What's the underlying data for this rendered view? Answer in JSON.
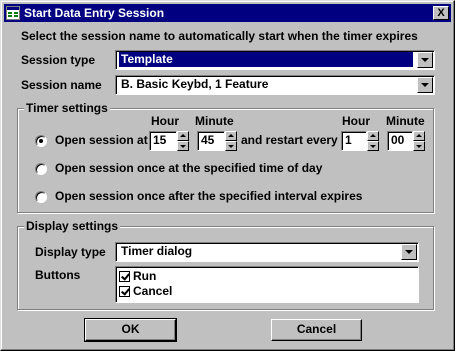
{
  "window": {
    "title": "Start Data Entry Session",
    "close_label": "X",
    "app_icon": "app-window-icon"
  },
  "instruction": "Select the session name to automatically start when the timer expires",
  "session_type": {
    "label": "Session type",
    "value": "Template"
  },
  "session_name": {
    "label": "Session name",
    "value": "B. Basic Keybd, 1 Feature"
  },
  "timer_settings": {
    "title": "Timer settings",
    "col_hour": "Hour",
    "col_minute": "Minute",
    "col_hour2": "Hour",
    "col_minute2": "Minute",
    "option_at": {
      "label": "Open session at",
      "selected": true,
      "hour": "15",
      "minute": "45"
    },
    "restart_label": "and restart every",
    "restart": {
      "hour": "1",
      "minute": "00"
    },
    "option_time_of_day": {
      "label": "Open session once at the specified time of day",
      "selected": false
    },
    "option_interval": {
      "label": "Open session once after the specified interval expires",
      "selected": false
    }
  },
  "display_settings": {
    "title": "Display settings",
    "display_type_label": "Display type",
    "display_type_value": "Timer dialog",
    "buttons_label": "Buttons",
    "buttons": [
      {
        "label": "Run",
        "checked": true
      },
      {
        "label": "Cancel",
        "checked": true
      }
    ]
  },
  "actions": {
    "ok": "OK",
    "cancel": "Cancel"
  },
  "colors": {
    "face": "#c0c0c0",
    "title_bar": "#000080",
    "selection": "#000080"
  }
}
